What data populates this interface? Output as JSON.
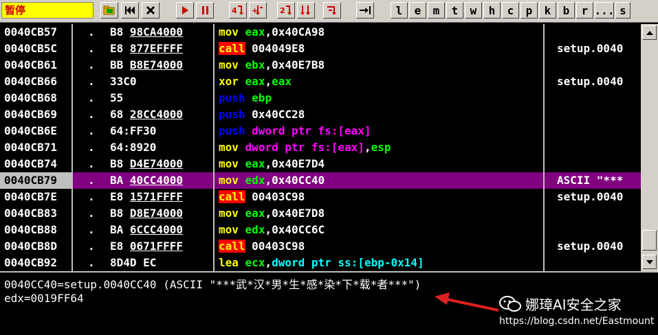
{
  "toolbar": {
    "status": "暂停",
    "letter_buttons": [
      "l",
      "e",
      "m",
      "t",
      "w",
      "h",
      "c",
      "p",
      "k",
      "b",
      "r",
      "...",
      "s"
    ]
  },
  "rows": [
    {
      "addr": "0040CB57",
      "dot": ".",
      "hex_a": "B8 ",
      "hex_b": "98CA4000",
      "ops": [
        [
          "op-mov",
          "mov"
        ],
        [
          "txt",
          " "
        ],
        [
          "reg",
          "eax"
        ],
        [
          "txt",
          ",0x40CA98"
        ]
      ],
      "cmt": ""
    },
    {
      "addr": "0040CB5C",
      "dot": ".",
      "hex_a": "E8 ",
      "hex_b": "877EFFFF",
      "ops": [
        [
          "op-call",
          "call"
        ],
        [
          "txt",
          " 004049E8"
        ]
      ],
      "cmt": "setup.0040"
    },
    {
      "addr": "0040CB61",
      "dot": ".",
      "hex_a": "BB ",
      "hex_b": "B8E74000",
      "ops": [
        [
          "op-mov",
          "mov"
        ],
        [
          "txt",
          " "
        ],
        [
          "reg",
          "ebx"
        ],
        [
          "txt",
          ",0x40E7B8"
        ]
      ],
      "cmt": ""
    },
    {
      "addr": "0040CB66",
      "dot": ".",
      "hex_a": "33C0",
      "hex_b": "",
      "ops": [
        [
          "op-xor",
          "xor"
        ],
        [
          "txt",
          " "
        ],
        [
          "reg",
          "eax"
        ],
        [
          "txt",
          ","
        ],
        [
          "reg",
          "eax"
        ]
      ],
      "cmt": "setup.0040"
    },
    {
      "addr": "0040CB68",
      "dot": ".",
      "hex_a": "55",
      "hex_b": "",
      "ops": [
        [
          "op-push",
          "push"
        ],
        [
          "txt",
          " "
        ],
        [
          "reg",
          "ebp"
        ]
      ],
      "cmt": ""
    },
    {
      "addr": "0040CB69",
      "dot": ".",
      "hex_a": "68 ",
      "hex_b": "28CC4000",
      "ops": [
        [
          "op-push",
          "push"
        ],
        [
          "txt",
          " 0x40CC28"
        ]
      ],
      "cmt": ""
    },
    {
      "addr": "0040CB6E",
      "dot": ".",
      "hex_a": "64:FF30",
      "hex_b": "",
      "ops": [
        [
          "op-push",
          "push"
        ],
        [
          "txt",
          " "
        ],
        [
          "ptr",
          "dword ptr fs:[eax]"
        ]
      ],
      "cmt": ""
    },
    {
      "addr": "0040CB71",
      "dot": ".",
      "hex_a": "64:8920",
      "hex_b": "",
      "ops": [
        [
          "op-mov",
          "mov"
        ],
        [
          "txt",
          " "
        ],
        [
          "ptr",
          "dword ptr fs:[eax]"
        ],
        [
          "txt",
          ","
        ],
        [
          "reg",
          "esp"
        ]
      ],
      "cmt": ""
    },
    {
      "addr": "0040CB74",
      "dot": ".",
      "hex_a": "B8 ",
      "hex_b": "D4E74000",
      "ops": [
        [
          "op-mov",
          "mov"
        ],
        [
          "txt",
          " "
        ],
        [
          "reg",
          "eax"
        ],
        [
          "txt",
          ",0x40E7D4"
        ]
      ],
      "cmt": ""
    },
    {
      "addr": "0040CB79",
      "dot": ".",
      "hex_a": "BA ",
      "hex_b": "40CC4000",
      "ops": [
        [
          "op-mov",
          "mov"
        ],
        [
          "txt",
          " "
        ],
        [
          "reg",
          "edx"
        ],
        [
          "txt",
          ",0x40CC40"
        ]
      ],
      "cmt": "ASCII \"***",
      "sel": true
    },
    {
      "addr": "0040CB7E",
      "dot": ".",
      "hex_a": "E8 ",
      "hex_b": "1571FFFF",
      "ops": [
        [
          "op-call",
          "call"
        ],
        [
          "txt",
          " 00403C98"
        ]
      ],
      "cmt": "setup.0040"
    },
    {
      "addr": "0040CB83",
      "dot": ".",
      "hex_a": "B8 ",
      "hex_b": "D8E74000",
      "ops": [
        [
          "op-mov",
          "mov"
        ],
        [
          "txt",
          " "
        ],
        [
          "reg",
          "eax"
        ],
        [
          "txt",
          ",0x40E7D8"
        ]
      ],
      "cmt": ""
    },
    {
      "addr": "0040CB88",
      "dot": ".",
      "hex_a": "BA ",
      "hex_b": "6CCC4000",
      "ops": [
        [
          "op-mov",
          "mov"
        ],
        [
          "txt",
          " "
        ],
        [
          "reg",
          "edx"
        ],
        [
          "txt",
          ",0x40CC6C"
        ]
      ],
      "cmt": ""
    },
    {
      "addr": "0040CB8D",
      "dot": ".",
      "hex_a": "E8 ",
      "hex_b": "0671FFFF",
      "ops": [
        [
          "op-call",
          "call"
        ],
        [
          "txt",
          " 00403C98"
        ]
      ],
      "cmt": "setup.0040"
    },
    {
      "addr": "0040CB92",
      "dot": ".",
      "hex_a": "8D4D EC",
      "hex_b": "",
      "ops": [
        [
          "op-lea",
          "lea"
        ],
        [
          "txt",
          " "
        ],
        [
          "reg",
          "ecx"
        ],
        [
          "txt",
          ","
        ],
        [
          "ptr2",
          "dword ptr ss:[ebp-0x14]"
        ]
      ],
      "cmt": ""
    }
  ],
  "info": {
    "line1": "0040CC40=setup.0040CC40 (ASCII \"***武*汉*男*生*感*染*下*载*者***\")",
    "line2": "edx=0019FF64"
  },
  "watermark": {
    "title": "娜璋AI安全之家",
    "url": "https://blog.csdn.net/Eastmount"
  }
}
